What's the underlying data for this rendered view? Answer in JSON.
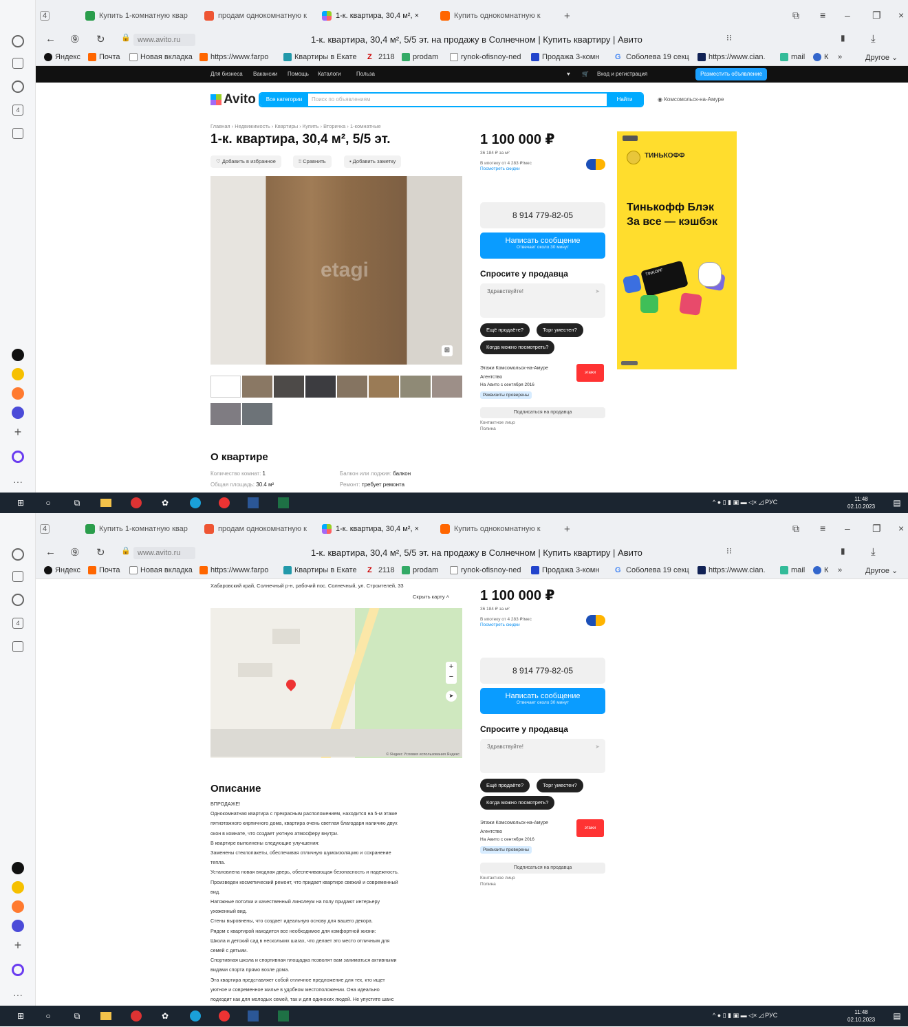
{
  "browser": {
    "tab_count": "4",
    "tabs": [
      {
        "label": "Купить 1-комнатную квар"
      },
      {
        "label": "продам однокомнатную к"
      },
      {
        "label": "1-к. квартира, 30,4 м², ×"
      },
      {
        "label": "Купить однокомнатную к"
      }
    ],
    "new_tab": "+",
    "url": "www.avito.ru",
    "page_title": "1-к. квартира, 30,4 м², 5/5 эт. на продажу в Солнечном | Купить квартиру | Авито",
    "bookmarks": [
      "Яндекс",
      "Почта",
      "Новая вкладка",
      "https://www.farpo",
      "Квартиры в Екате",
      "2118",
      "prodam",
      "rynok-ofisnoy-ned",
      "Продажа 3-комн",
      "Соболева 19 секц",
      "https://www.cian.",
      "mail",
      "К",
      "»",
      "Другое"
    ]
  },
  "avito": {
    "top_nav": [
      "Для бизнеса",
      "Вакансии",
      "Помощь",
      "Каталоги",
      "Польза"
    ],
    "login": "Вход и регистрация",
    "post_ad": "Разместить объявление",
    "logo": "Avito",
    "all_categories": "Все категории",
    "search_placeholder": "Поиск по объявлениям",
    "search_button": "Найти",
    "city": "Комсомольск-на-Амуре",
    "breadcrumbs": "Главная › Недвижимость › Квартиры › Купить › Вторичка › 1-комнатные",
    "title": "1-к. квартира, 30,4 м², 5/5 эт.",
    "actions": [
      "Добавить в избранное",
      "Сравнить",
      "Добавить заметку"
    ],
    "price": "1 100 000 ₽",
    "price_per_m": "36 184 ₽ за м²",
    "mortgage": "В ипотеку от 4 283 ₽/мес",
    "mortgage_link": "Посмотреть скидки",
    "phone": "8 914 779-82-05",
    "write_msg": "Написать сообщение",
    "write_msg_sub": "Отвечает около 30 минут",
    "ask_title": "Спросите у продавца",
    "ask_placeholder": "Здравствуйте!",
    "quick_q": [
      "Ещё продаёте?",
      "Торг уместен?",
      "Когда можно посмотреть?"
    ],
    "seller_name": "Этажи Комсомольск-на-Амуре",
    "seller_type": "Агентство",
    "seller_since": "На Авито с сентября 2016",
    "seller_verified": "Реквизиты проверены",
    "seller_badge": "этажи",
    "subscribe": "Подписаться на продавца",
    "contact": "Контактное лицо",
    "contact_name": "Полина",
    "about_title": "О квартире",
    "props": [
      {
        "k": "Количество комнат:",
        "v": "1"
      },
      {
        "k": "Общая площадь:",
        "v": "30.4 м²"
      },
      {
        "k": "Балкон или лоджия:",
        "v": "балкон"
      },
      {
        "k": "Ремонт:",
        "v": "требует ремонта"
      }
    ],
    "address": "Хабаровский край, Солнечный р-н, рабочий пос. Солнечный, ул. Строителей, 33",
    "hide_map": "Скрыть карту",
    "map_footer": "© Яндекс  Условия использования  Яндекс",
    "desc_title": "Описание",
    "desc_lines": [
      "ВПРОДАЖЕ!",
      "Однокомнатная квартира с прекрасным расположением, находится на 5-м этаже",
      "пятиэтажного кирпичного дома, квартира очень светлая благодаря наличию двух",
      "окон в комнате, что создает уютную атмосферу внутри.",
      "В квартире выполнены следующие улучшения:",
      "Заменены стеклопакеты, обеспечивая отличную шумоизоляцию и сохранение",
      "тепла.",
      "Установлена новая входная дверь, обеспечивающая безопасность и надежность.",
      "Произведен косметический ремонт, что придает квартире свежий и современный",
      "вид.",
      "Натяжные потолки и качественный линолеум на полу придают интерьеру",
      "ухоженный вид.",
      "Стены выровнены, что создает идеальную основу для вашего декора.",
      "Рядом с квартирой находится все необходимое для комфортной жизни:",
      "Школа и детский сад в нескольких шагах, что делает это место отличным для",
      "семей с детьми.",
      "Спортивная школа и спортивная площадка позволят вам заниматься активными",
      "видами спорта прямо возле дома.",
      "Эта квартира представляет собой отличное предложение для тех, кто ищет",
      "уютное и современное жилье в удобном местоположении. Она идеально",
      "подходит как для молодых семей, так и для одиноких людей. Не упустите шанс"
    ]
  },
  "ad": {
    "brand": "ТИНЬКОФФ",
    "headline1": "Тинькофф Блэк",
    "headline2": "За все — кэшбэк",
    "card": "TINKOFF"
  },
  "taskbar": {
    "lang": "РУС",
    "time": "11:48",
    "date": "02.10.2023"
  }
}
